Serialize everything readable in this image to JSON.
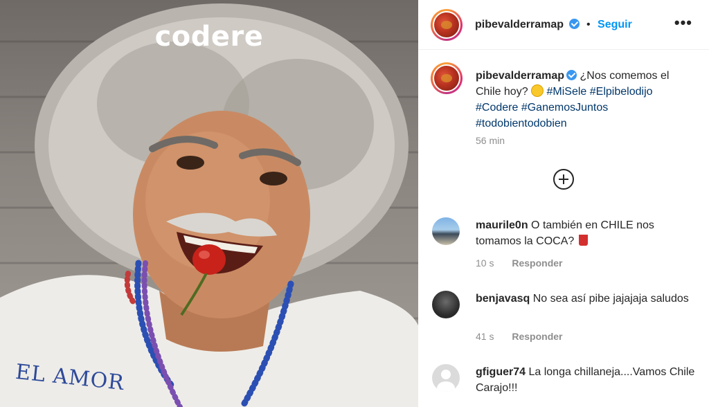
{
  "photo": {
    "brand_logo": "codere",
    "shirt_text": "EL AMOR"
  },
  "header": {
    "username": "pibevalderramap",
    "separator": "•",
    "follow_label": "Seguir",
    "more_icon": "more-horizontal-icon"
  },
  "caption": {
    "username": "pibevalderramap",
    "text_before_emoji": "¿Nos comemos el Chile hoy?",
    "emoji": "smiling-face-icon",
    "hashtags": [
      "#MiSele",
      "#Elpibelodijo",
      "#Codere",
      "#GanemosJuntos",
      "#todobientodobien"
    ],
    "time": "56 min"
  },
  "load_more_icon": "plus-circle-icon",
  "comments": [
    {
      "username": "maurile0n",
      "text": "O también en CHILE nos tomamos la COCA?",
      "emoji": "cup-icon",
      "time": "10 s",
      "reply_label": "Responder"
    },
    {
      "username": "benjavasq",
      "text": "No sea así pibe jajajaja saludos",
      "time": "41 s",
      "reply_label": "Responder"
    },
    {
      "username": "gfiguer74",
      "text": "La longa chillaneja....Vamos Chile Carajo!!!"
    }
  ],
  "colors": {
    "link_blue": "#0095f6",
    "hashtag_blue": "#00376b",
    "muted_gray": "#8e8e8e",
    "verified_blue": "#3897f0"
  }
}
